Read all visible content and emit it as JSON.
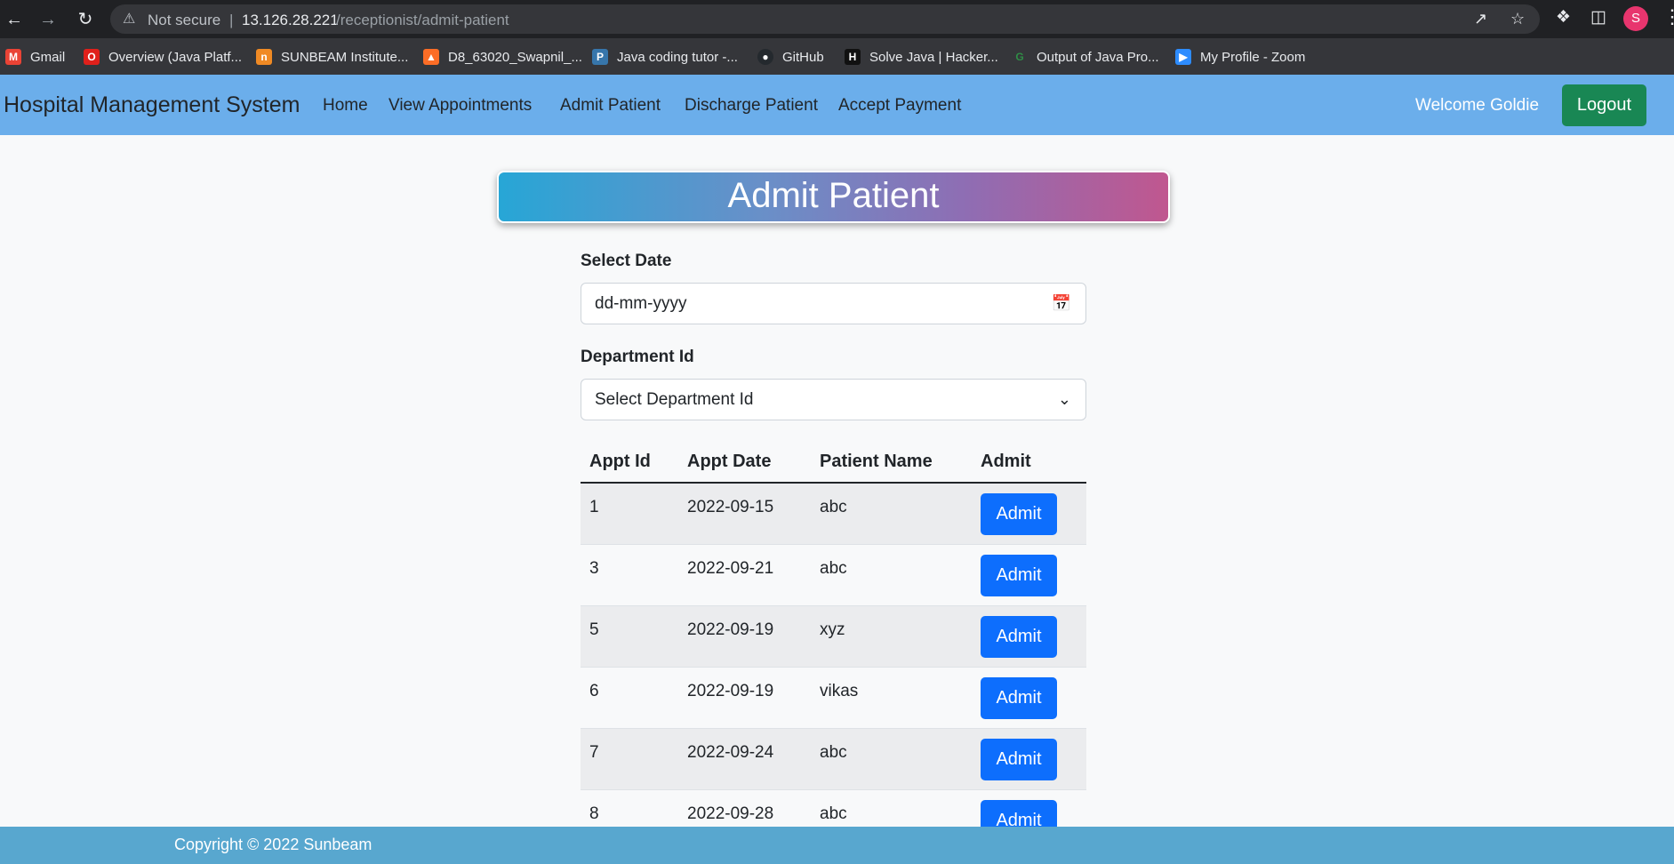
{
  "browser": {
    "not_secure": "Not secure",
    "separator": "|",
    "url_host": "13.126.28.221",
    "url_path": "/receptionist/admit-patient",
    "avatar_letter": "S",
    "bookmarks": [
      {
        "label": "Gmail",
        "icon": "gmail-icon",
        "color": "#ea4335"
      },
      {
        "label": "Overview (Java Platf...",
        "icon": "oracle-icon",
        "color": "#e0201b"
      },
      {
        "label": "SUNBEAM Institute...",
        "icon": "sunbeam-icon",
        "color": "#f08a24"
      },
      {
        "label": "D8_63020_Swapnil_...",
        "icon": "gitlab-icon",
        "color": "#fc6d26"
      },
      {
        "label": "Java coding tutor -...",
        "icon": "python-icon",
        "color": "#3776ab"
      },
      {
        "label": "GitHub",
        "icon": "github-icon",
        "color": "#24292e"
      },
      {
        "label": "Solve Java | Hacker...",
        "icon": "hackerrank-icon",
        "color": "#1ba94c"
      },
      {
        "label": "Output of Java Pro...",
        "icon": "geeksforgeeks-icon",
        "color": "#2f8d46"
      },
      {
        "label": "My Profile - Zoom",
        "icon": "zoom-icon",
        "color": "#2d8cff"
      }
    ]
  },
  "navbar": {
    "brand": "Hospital Management System",
    "links": [
      "Home",
      "View Appointments",
      "Admit Patient",
      "Discharge Patient",
      "Accept Payment"
    ],
    "welcome": "Welcome Goldie",
    "logout": "Logout"
  },
  "page": {
    "title": "Admit Patient",
    "date_label": "Select Date",
    "date_placeholder": "dd-mm-yyyy",
    "dept_label": "Department Id",
    "dept_selected": "Select Department Id"
  },
  "table": {
    "headers": [
      "Appt Id",
      "Appt Date",
      "Patient Name",
      "Admit"
    ],
    "rows": [
      {
        "id": "1",
        "date": "2022-09-15",
        "name": "abc",
        "action": "Admit"
      },
      {
        "id": "3",
        "date": "2022-09-21",
        "name": "abc",
        "action": "Admit"
      },
      {
        "id": "5",
        "date": "2022-09-19",
        "name": "xyz",
        "action": "Admit"
      },
      {
        "id": "6",
        "date": "2022-09-19",
        "name": "vikas",
        "action": "Admit"
      },
      {
        "id": "7",
        "date": "2022-09-24",
        "name": "abc",
        "action": "Admit"
      },
      {
        "id": "8",
        "date": "2022-09-28",
        "name": "abc",
        "action": "Admit"
      }
    ]
  },
  "footer": {
    "text": "Copyright © 2022 Sunbeam"
  }
}
